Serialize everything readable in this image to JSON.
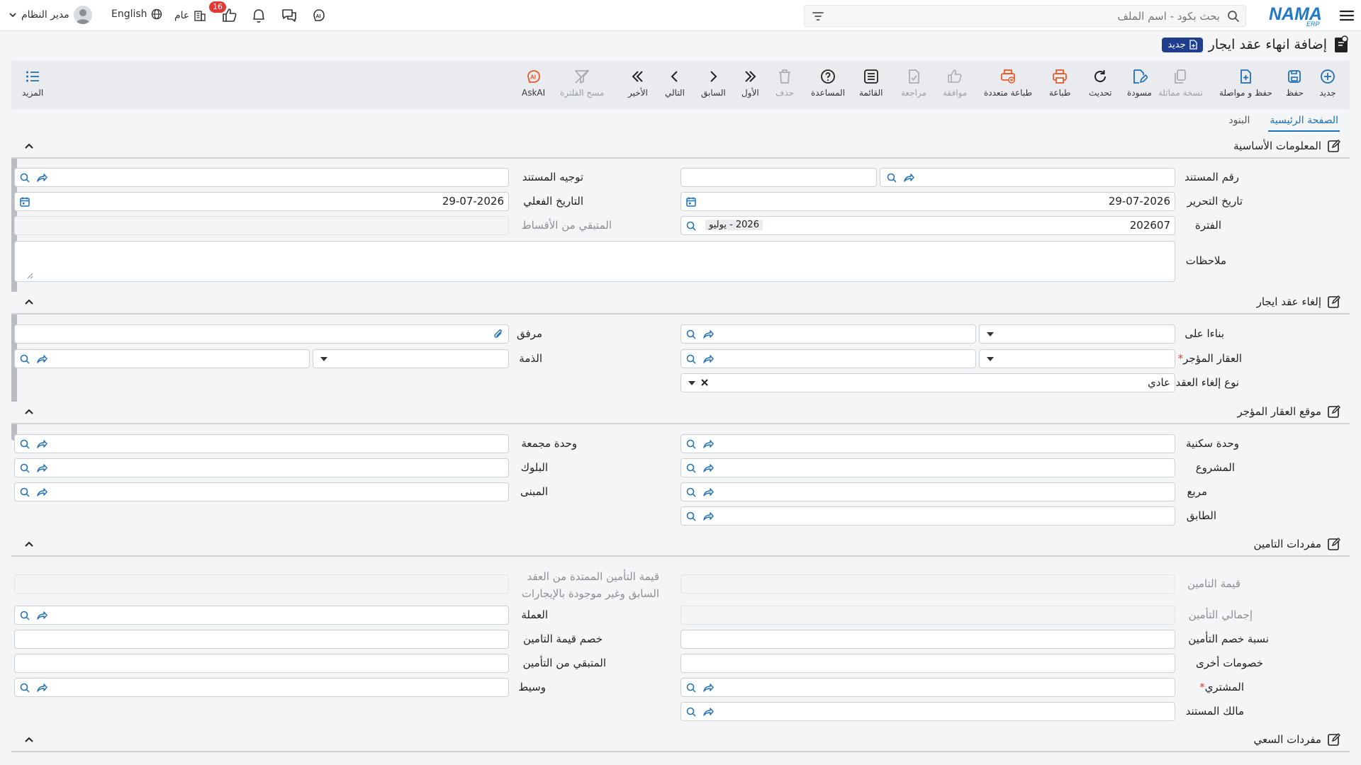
{
  "topbar": {
    "search_placeholder": "بحث بكود - اسم الملف",
    "user_name": "مدير النظام",
    "language": "English",
    "scope": "عام",
    "notif_count": "16"
  },
  "page": {
    "title": "إضافة انهاء عقد ايجار",
    "new_badge": "جديد"
  },
  "toolbar": {
    "new": "جديد",
    "save": "حفظ",
    "save_continue": "حفظ و مواصلة",
    "similar_copy": "نسخة مماثلة",
    "draft": "مسودة",
    "refresh": "تحديث",
    "print": "طباعة",
    "multi_print": "طباعة متعددة",
    "approve": "موافقة",
    "review": "مراجعة",
    "list": "القائمة",
    "help": "المساعدة",
    "delete": "حذف",
    "first": "الأول",
    "previous": "السابق",
    "next": "التالي",
    "last": "الأخير",
    "clear_filter": "مسح الفلترة",
    "askai": "AskAI",
    "more": "المزيد"
  },
  "tabs": [
    "الصفحة الرئيسية",
    "البنود"
  ],
  "sections": {
    "basic": "المعلومات الأساسية",
    "cancel": "إلغاء عقد ايجار",
    "location": "موقع العقار المؤجر",
    "insurance": "مفردات التامين",
    "brokerage": "مفردات السعي"
  },
  "fields": {
    "doc_number": "رقم المستند",
    "doc_direction": "توجيه المستند",
    "edit_date": "تاريخ التحرير",
    "edit_date_value": "29-07-2026",
    "actual_date": "التاريخ الفعلي",
    "actual_date_value": "29-07-2026",
    "period": "الفترة",
    "period_value": "202607",
    "period_chip": "2026 - يوليو",
    "remaining_installments": "المتبقي من الأقساط",
    "notes": "ملاحظات",
    "based_on": "بناءا على",
    "attachment": "مرفق",
    "leased_property": "العقار المؤجر",
    "liability": "الذمة",
    "cancel_type": "نوع إلغاء العقد",
    "cancel_type_value": "عادي",
    "residential_unit": "وحدة سكنية",
    "combined_unit": "وحدة مجمعة",
    "project": "المشروع",
    "block": "البلوك",
    "square": "مربع",
    "building": "المبنى",
    "floor": "الطابق",
    "insurance_value": "قيمة التامين",
    "extended_insurance": "قيمة التأمين الممتدة من العقد السابق وغير موجودة بالإيجارات",
    "total_insurance": "إجمالي التأمين",
    "currency": "العملة",
    "insurance_discount_rate": "نسبة خصم التأمين",
    "insurance_discount_value": "خصم قيمة التامين",
    "other_discounts": "خصومات أخرى",
    "remaining_insurance": "المتبقي من التأمين",
    "buyer": "المشتري",
    "broker": "وسيط",
    "doc_owner": "مالك المستند"
  },
  "colors": {
    "accent": "#1f6fb8",
    "brand_dark": "#1f3f8e",
    "orange": "#e8592b",
    "badge_red": "#e53935"
  }
}
